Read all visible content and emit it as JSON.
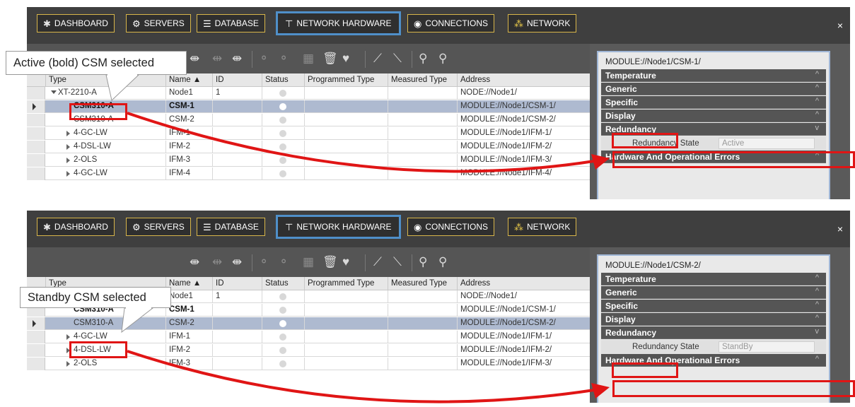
{
  "tabs": [
    {
      "label": "DASHBOARD",
      "icon": "dashboard-icon"
    },
    {
      "label": "SERVERS",
      "icon": "gear-icon"
    },
    {
      "label": "DATABASE",
      "icon": "database-icon"
    },
    {
      "label": "NETWORK HARDWARE",
      "icon": "network-hardware-icon",
      "active": true
    },
    {
      "label": "CONNECTIONS",
      "icon": "connections-icon"
    },
    {
      "label": "NETWORK",
      "icon": "network-icon"
    }
  ],
  "close_label": "×",
  "columns": {
    "type": "Type",
    "name": "Name",
    "id": "ID",
    "status": "Status",
    "programmed_type": "Programmed Type",
    "measured_type": "Measured Type",
    "address": "Address"
  },
  "colors": {
    "highlight": "#e01515",
    "active_tab": "#4f8fc9",
    "tab_border": "#d8b64a",
    "selected_row": "#aebad0"
  },
  "panels": [
    {
      "callout": "Active (bold) CSM selected",
      "rows": [
        {
          "type": "XT-2210-A",
          "name": "Node1",
          "id": "1",
          "address": "NODE://Node1/"
        },
        {
          "type": "CSM310-A",
          "name": "CSM-1",
          "id": "",
          "address": "MODULE://Node1/CSM-1/"
        },
        {
          "type": "CSM310-A",
          "name": "CSM-2",
          "id": "",
          "address": "MODULE://Node1/CSM-2/"
        },
        {
          "type": "4-GC-LW",
          "name": "IFM-1",
          "id": "",
          "address": "MODULE://Node1/IFM-1/"
        },
        {
          "type": "4-DSL-LW",
          "name": "IFM-2",
          "id": "",
          "address": "MODULE://Node1/IFM-2/"
        },
        {
          "type": "2-OLS",
          "name": "IFM-3",
          "id": "",
          "address": "MODULE://Node1/IFM-3/"
        },
        {
          "type": "4-GC-LW",
          "name": "IFM-4",
          "id": "",
          "address": "MODULE://Node1/IFM-4/"
        }
      ],
      "selected_row": 1,
      "properties": {
        "title": "MODULE://Node1/CSM-1/",
        "categories": [
          "Temperature",
          "Generic",
          "Specific",
          "Display",
          "Redundancy",
          "Hardware And Operational Errors"
        ],
        "redundancy_state_label": "Redundancy State",
        "redundancy_state_value": "Active"
      }
    },
    {
      "callout": "Standby CSM selected",
      "rows": [
        {
          "type": "XT-2210-A",
          "name": "Node1",
          "id": "1",
          "address": "NODE://Node1/"
        },
        {
          "type": "CSM310-A",
          "name": "CSM-1",
          "id": "",
          "address": "MODULE://Node1/CSM-1/"
        },
        {
          "type": "CSM310-A",
          "name": "CSM-2",
          "id": "",
          "address": "MODULE://Node1/CSM-2/"
        },
        {
          "type": "4-GC-LW",
          "name": "IFM-1",
          "id": "",
          "address": "MODULE://Node1/IFM-1/"
        },
        {
          "type": "4-DSL-LW",
          "name": "IFM-2",
          "id": "",
          "address": "MODULE://Node1/IFM-2/"
        },
        {
          "type": "2-OLS",
          "name": "IFM-3",
          "id": "",
          "address": "MODULE://Node1/IFM-3/"
        }
      ],
      "selected_row": 2,
      "properties": {
        "title": "MODULE://Node1/CSM-2/",
        "categories": [
          "Temperature",
          "Generic",
          "Specific",
          "Display",
          "Redundancy",
          "Hardware And Operational Errors"
        ],
        "redundancy_state_label": "Redundancy State",
        "redundancy_state_value": "StandBy"
      }
    }
  ]
}
